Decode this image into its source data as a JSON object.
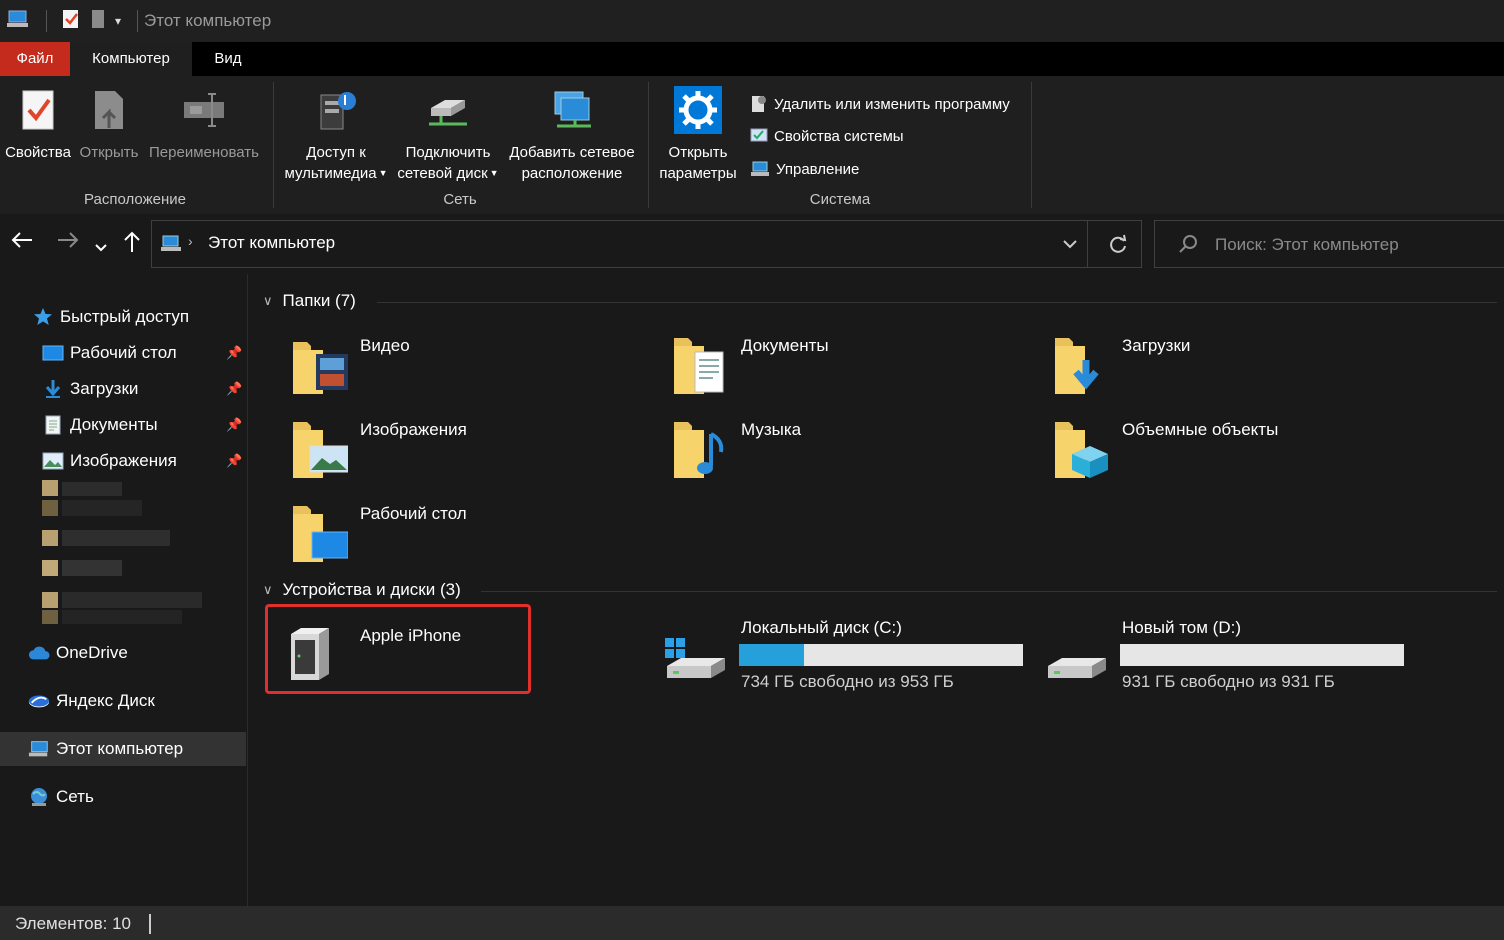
{
  "window": {
    "title": "Этот компьютер"
  },
  "tabs": {
    "file": "Файл",
    "computer": "Компьютер",
    "view": "Вид"
  },
  "ribbon": {
    "location": {
      "label": "Расположение",
      "properties": "Свойства",
      "open": "Открыть",
      "rename": "Переименовать"
    },
    "network": {
      "label": "Сеть",
      "media_line1": "Доступ к",
      "media_line2": "мультимедиа",
      "map_line1": "Подключить",
      "map_line2": "сетевой диск",
      "add_line1": "Добавить сетевое",
      "add_line2": "расположение"
    },
    "system": {
      "label": "Система",
      "open_line1": "Открыть",
      "open_line2": "параметры",
      "uninstall": "Удалить или изменить программу",
      "sys_props": "Свойства системы",
      "manage": "Управление"
    }
  },
  "address": {
    "path": "Этот компьютер",
    "search_placeholder": "Поиск: Этот компьютер"
  },
  "sidebar": {
    "quick_access": "Быстрый доступ",
    "desktop": "Рабочий стол",
    "downloads": "Загрузки",
    "documents": "Документы",
    "pictures": "Изображения",
    "onedrive": "OneDrive",
    "yandex": "Яндекс Диск",
    "this_pc": "Этот компьютер",
    "network": "Сеть"
  },
  "folders": {
    "header": "Папки (7)",
    "items": [
      "Видео",
      "Документы",
      "Загрузки",
      "Изображения",
      "Музыка",
      "Объемные объекты",
      "Рабочий стол"
    ]
  },
  "devices": {
    "header": "Устройства и диски (3)",
    "iphone": "Apple iPhone",
    "c": {
      "name": "Локальный диск (C:)",
      "free": "734 ГБ свободно из 953 ГБ",
      "used_fraction": 0.23
    },
    "d": {
      "name": "Новый том (D:)",
      "free": "931 ГБ свободно из 931 ГБ",
      "used_fraction": 0.0
    }
  },
  "status": {
    "items": "Элементов: 10"
  },
  "colors": {
    "accent": "#26a0da",
    "file_tab": "#c42b1c",
    "highlight": "#e0302b"
  }
}
